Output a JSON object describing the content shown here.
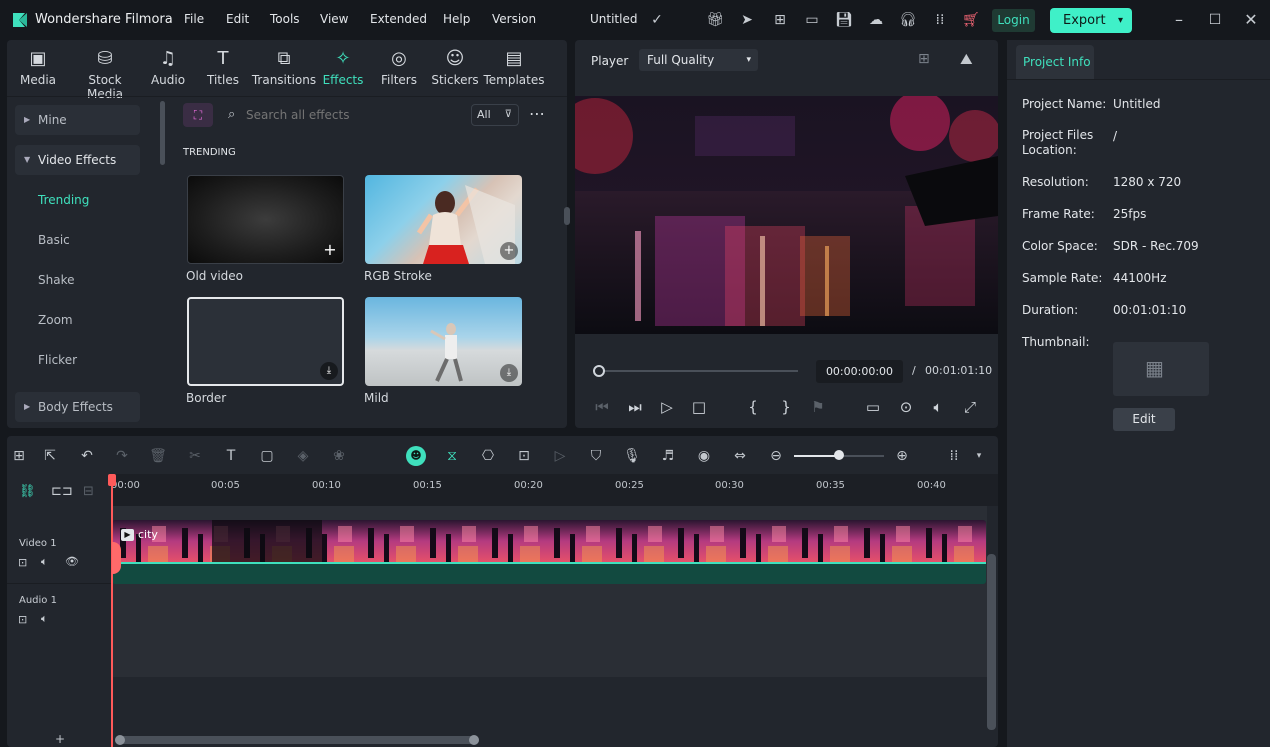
{
  "app": {
    "name": "Wondershare Filmora",
    "project_title": "Untitled"
  },
  "menu": [
    "File",
    "Edit",
    "Tools",
    "View",
    "Extended",
    "Help",
    "Version"
  ],
  "header": {
    "login_label": "Login",
    "export_label": "Export"
  },
  "media_tabs": [
    {
      "label": "Media",
      "icon": "media-icon"
    },
    {
      "label": "Stock Media",
      "icon": "stock-media-icon"
    },
    {
      "label": "Audio",
      "icon": "audio-icon"
    },
    {
      "label": "Titles",
      "icon": "titles-icon"
    },
    {
      "label": "Transitions",
      "icon": "transitions-icon"
    },
    {
      "label": "Effects",
      "icon": "effects-icon"
    },
    {
      "label": "Filters",
      "icon": "filters-icon"
    },
    {
      "label": "Stickers",
      "icon": "stickers-icon"
    },
    {
      "label": "Templates",
      "icon": "templates-icon"
    }
  ],
  "sidebar": {
    "items": [
      {
        "label": "Mine"
      },
      {
        "label": "Video Effects"
      },
      {
        "label": "Trending"
      },
      {
        "label": "Basic"
      },
      {
        "label": "Shake"
      },
      {
        "label": "Zoom"
      },
      {
        "label": "Flicker"
      },
      {
        "label": "Body Effects"
      }
    ]
  },
  "effects": {
    "search_placeholder": "Search all effects",
    "filter_label": "All",
    "section_title": "TRENDING",
    "items": [
      {
        "label": "Old video"
      },
      {
        "label": "RGB Stroke"
      },
      {
        "label": "Border"
      },
      {
        "label": "Mild"
      }
    ]
  },
  "player": {
    "label": "Player",
    "quality": "Full Quality",
    "current_time": "00:00:00:00",
    "separator": "/",
    "total_time": "00:01:01:10"
  },
  "project_info": {
    "tab_label": "Project Info",
    "fields": [
      {
        "label": "Project Name:",
        "value": "Untitled"
      },
      {
        "label": "Project Files Location:",
        "value": "/"
      },
      {
        "label": "Resolution:",
        "value": "1280 x 720"
      },
      {
        "label": "Frame Rate:",
        "value": "25fps"
      },
      {
        "label": "Color Space:",
        "value": "SDR - Rec.709"
      },
      {
        "label": "Sample Rate:",
        "value": "44100Hz"
      },
      {
        "label": "Duration:",
        "value": "00:01:01:10"
      },
      {
        "label": "Thumbnail:",
        "value": ""
      }
    ],
    "edit_label": "Edit"
  },
  "timeline": {
    "ruler": [
      "00:00",
      "00:05",
      "00:10",
      "00:15",
      "00:20",
      "00:25",
      "00:30",
      "00:35",
      "00:40"
    ],
    "tracks": [
      {
        "label": "Video 1"
      },
      {
        "label": "Audio 1"
      }
    ],
    "clip_name": "city"
  },
  "colors": {
    "accent": "#3fe0bd",
    "playhead": "#ff5a5a"
  }
}
